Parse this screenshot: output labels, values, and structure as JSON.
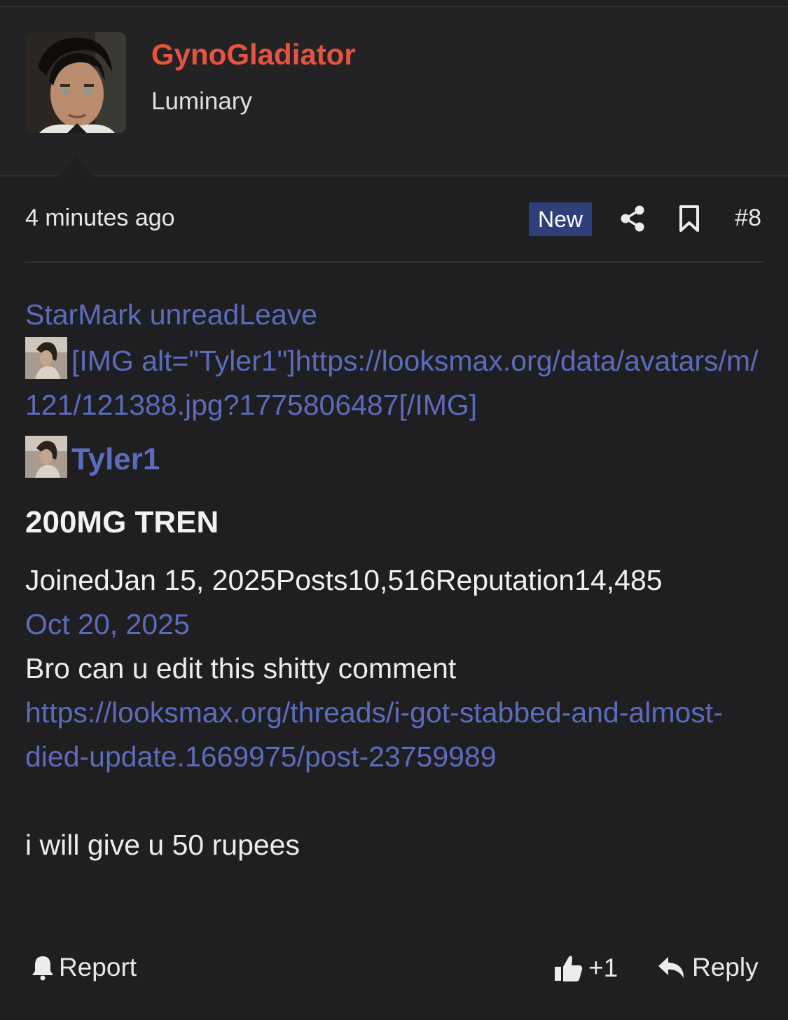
{
  "author": {
    "username": "GynoGladiator",
    "title": "Luminary"
  },
  "post_header": {
    "time": "4 minutes ago",
    "badge": "New",
    "post_number": "#8"
  },
  "body": {
    "leading_link": "StarMark unreadLeave",
    "img_bbcode": "[IMG alt=\"Tyler1\"]https://looksmax.org/data/avatars/m/121/121388.jpg?1775806487[/IMG]",
    "quote_user": "Tyler1",
    "quote_heading": "200MG TREN",
    "meta_line": "JoinedJan 15, 2025Posts10,516Reputation14,485",
    "date": "Oct 20, 2025",
    "message": "Bro can u edit this shitty comment",
    "message_link": "https://looksmax.org/threads/i-got-stabbed-and-almost-died-update.1669975/post-23759989",
    "closing": "i will give u 50 rupees"
  },
  "footer": {
    "report_label": "Report",
    "reaction_count": "+1",
    "reply_label": "Reply"
  },
  "icons": {
    "share": "share-icon",
    "bookmark": "bookmark-icon",
    "bell": "bell-icon",
    "thumbs_up": "thumbs-up-icon",
    "reply": "reply-arrow-icon"
  },
  "colors": {
    "username": "#e8533f",
    "link": "#5d6bbd",
    "badge_bg": "#2f3f7a",
    "background": "#1f1f21"
  }
}
